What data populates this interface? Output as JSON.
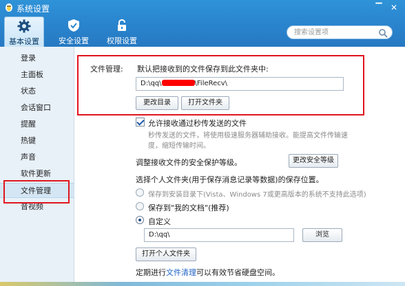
{
  "window": {
    "title": "系统设置",
    "min_symbol": "▔",
    "close_symbol": "✕"
  },
  "tabs": [
    {
      "label": "基本设置",
      "icon": "gear-icon",
      "active": true
    },
    {
      "label": "安全设置",
      "icon": "shield-icon",
      "active": false
    },
    {
      "label": "权限设置",
      "icon": "lock-icon",
      "active": false
    }
  ],
  "search": {
    "placeholder": "搜索设置项"
  },
  "sidebar": {
    "items": [
      {
        "label": "登录"
      },
      {
        "label": "主面板"
      },
      {
        "label": "状态"
      },
      {
        "label": "会话窗口"
      },
      {
        "label": "提醒"
      },
      {
        "label": "热键"
      },
      {
        "label": "声音"
      },
      {
        "label": "软件更新"
      },
      {
        "label": "文件管理",
        "active": true
      },
      {
        "label": "音视频"
      }
    ]
  },
  "file_management": {
    "section_label": "文件管理:",
    "save_desc": "默认把接收到的文件保存到此文件夹中:",
    "path_prefix": "D:\\qq\\",
    "path_suffix": "\\FileRecv\\",
    "change_dir_button": "更改目录",
    "open_folder_button": "打开文件夹",
    "allow_relay_label": "允许接收通过秒传发送的文件",
    "allow_relay_checked": true,
    "relay_desc_line1": "秒传发送的文件，将使用极速服务器辅助接收。能提高文件传输速",
    "relay_desc_line2": "度，缩短传输时间。",
    "security_level_label": "调整接收文件的安全保护等级。",
    "security_level_button": "更改安全等级",
    "personal_folder_label": "选择个人文件夹(用于保存消息记录等数据)的保存位置。",
    "options": [
      {
        "label": "保存到安装目录下(Vista、Windows 7或更高版本的系统不支持此选项)",
        "selected": false,
        "disabled": true
      },
      {
        "label": "保存到\"我的文档\"(推荐)",
        "selected": false,
        "disabled": false
      },
      {
        "label": "自定义",
        "selected": true,
        "disabled": false
      }
    ],
    "custom_path": "D:\\qq\\",
    "browse_button": "浏览",
    "open_personal_folder_button": "打开个人文件夹",
    "cleanup_prefix": "定期进行",
    "cleanup_link": "文件清理",
    "cleanup_suffix": "可以有效节省硬盘空间。"
  },
  "colors": {
    "header_blue": "#2a86cf",
    "highlight_red": "#e0141e",
    "link_blue": "#1f63c4"
  }
}
